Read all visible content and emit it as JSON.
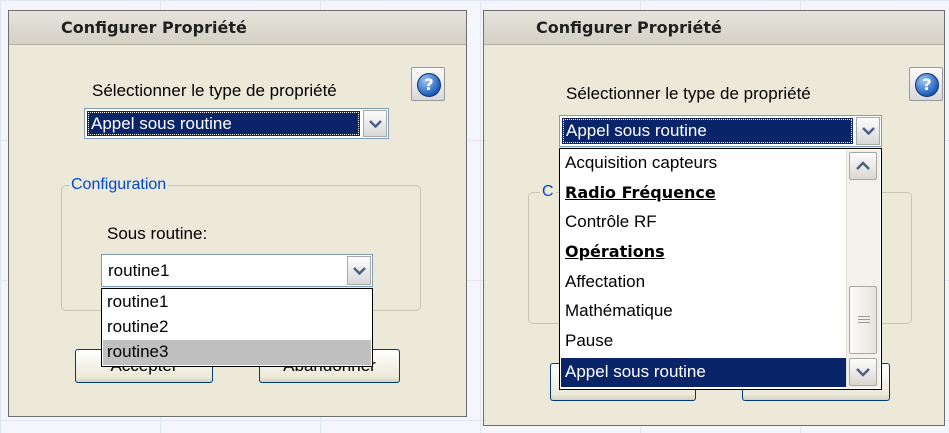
{
  "left_dialog": {
    "title": "Configurer Propriété",
    "help_glyph": "?",
    "property_type_label": "Sélectionner le type de propriété",
    "property_type_value": "Appel sous routine",
    "group_title": "Configuration",
    "subroutine_label": "Sous routine:",
    "subroutine_value": "routine1",
    "subroutine_options": [
      "routine1",
      "routine2",
      "routine3"
    ],
    "hovered_option": "routine3",
    "accept_label": "Accepter",
    "cancel_label": "Abandonner"
  },
  "right_dialog": {
    "title": "Configurer Propriété",
    "help_glyph": "?",
    "property_type_label": "Sélectionner le type de propriété",
    "property_type_value": "Appel sous routine",
    "group_title_partial": "C",
    "options": [
      {
        "label": "Acquisition capteurs",
        "kind": "item"
      },
      {
        "label": "Radio Fréquence",
        "kind": "category"
      },
      {
        "label": "Contrôle RF",
        "kind": "item"
      },
      {
        "label": "Opérations",
        "kind": "category"
      },
      {
        "label": "Affectation",
        "kind": "item"
      },
      {
        "label": "Mathématique",
        "kind": "item"
      },
      {
        "label": "Pause",
        "kind": "item"
      },
      {
        "label": "Appel sous routine",
        "kind": "selected"
      }
    ]
  },
  "colors": {
    "dialog_bg": "#ece9d8",
    "selection": "#0a246a",
    "group_title": "#0046d5",
    "hover": "#c0c0c0"
  }
}
